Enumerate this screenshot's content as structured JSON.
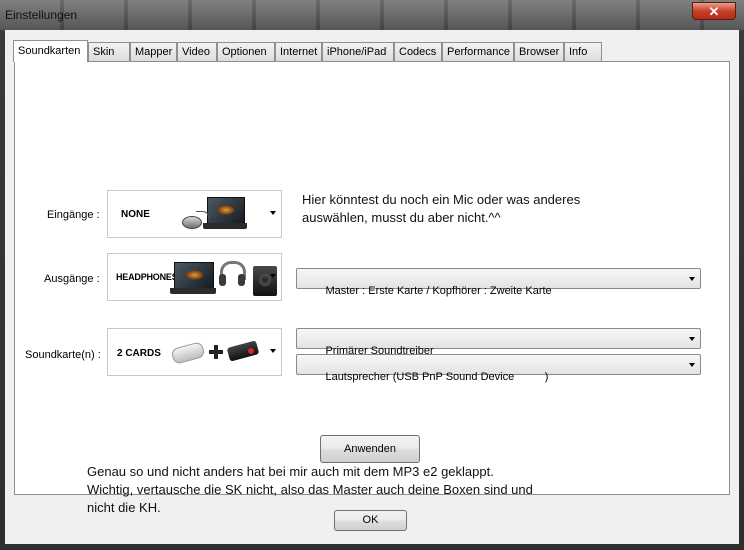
{
  "window": {
    "title": "Einstellungen",
    "close_symbol": "✕"
  },
  "tabs": [
    {
      "label": "Soundkarten",
      "active": true
    },
    {
      "label": "Skin"
    },
    {
      "label": "Mapper"
    },
    {
      "label": "Video"
    },
    {
      "label": "Optionen"
    },
    {
      "label": "Internet"
    },
    {
      "label": "iPhone/iPad"
    },
    {
      "label": "Codecs"
    },
    {
      "label": "Performance"
    },
    {
      "label": "Browser"
    },
    {
      "label": "Info"
    }
  ],
  "inputs": {
    "label": "Eingänge :",
    "selected": "NONE",
    "icon": "mouse-laptop-icon"
  },
  "outputs": {
    "label": "Ausgänge :",
    "selected": "HEADPHONES",
    "icon": "headphones-laptop-icon",
    "routing": "Master : Erste Karte / Kopfhörer : Zweite Karte"
  },
  "soundcards": {
    "label": "Soundkarte(n) :",
    "selected": "2 CARDS",
    "icon": "usb-soundcards-icon",
    "driver": "Primärer Soundtreiber",
    "device": "Lautsprecher (USB PnP Sound Device          )"
  },
  "annotations": {
    "input_note": [
      "Hier könntest du noch ein Mic oder was anderes",
      "auswählen, musst du aber nicht.^^"
    ],
    "bottom_note": [
      "Genau so und nicht anders hat bei mir auch mit dem MP3 e2 geklappt.",
      "Wichtig, vertausche die SK nicht, also das Master auch deine Boxen sind und",
      "nicht die KH."
    ]
  },
  "buttons": {
    "apply": "Anwenden",
    "ok": "OK"
  },
  "colors": {
    "title_bar": "#5a5a5a",
    "close_button": "#c7412a",
    "dialog_bg": "#f0f0f0"
  }
}
